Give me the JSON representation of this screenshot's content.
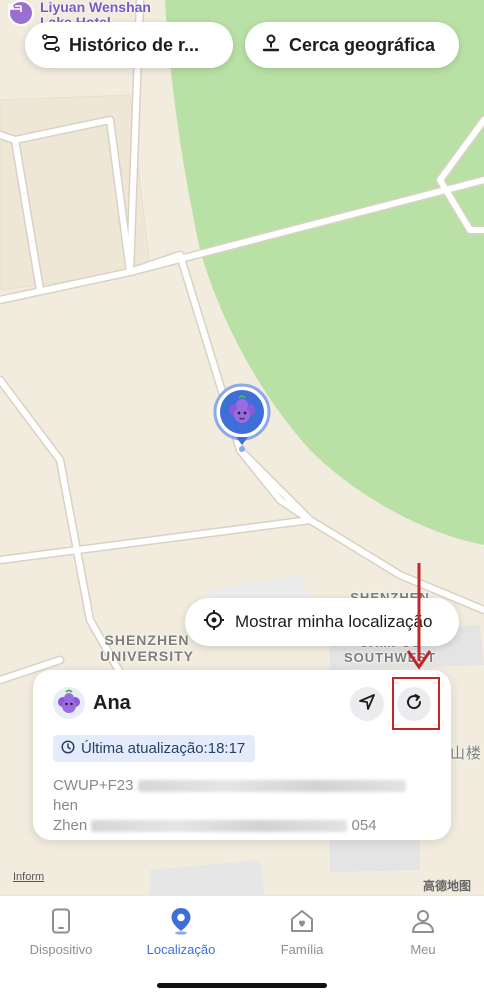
{
  "map": {
    "poi": {
      "line1": "Liyuan Wenshan",
      "line2": "Lake Hotel",
      "icon": "bed-icon"
    },
    "labels": {
      "university_l1": "SHENZHEN",
      "university_l2": "UNIVERSITY",
      "campus_l1": "SHENZHEN",
      "campus_l2": "CAMPUS",
      "campus_l3": "SOUTHWEST",
      "edge_text": "山楼"
    },
    "attribution": {
      "inform": "Inform",
      "provider": "高德地图"
    }
  },
  "top_buttons": {
    "history": {
      "label": "Histórico de r...",
      "icon": "route-icon"
    },
    "geofence": {
      "label": "Cerca geográfica",
      "icon": "location-pin-icon"
    }
  },
  "show_my_location": {
    "label": "Mostrar minha localização",
    "icon": "crosshair-icon"
  },
  "device_card": {
    "name": "Ana",
    "last_update": "Última atualização:18:17",
    "address_line1_start": "CWUP+F23",
    "address_line1_end": "hen",
    "address_line2_start": "Zhen",
    "address_line2_end": "054"
  },
  "tabs": [
    {
      "label": "Dispositivo",
      "icon": "phone-icon",
      "active": false
    },
    {
      "label": "Localização",
      "icon": "location-icon",
      "active": true
    },
    {
      "label": "Família",
      "icon": "home-heart-icon",
      "active": false
    },
    {
      "label": "Meu",
      "icon": "person-icon",
      "active": false
    }
  ],
  "colors": {
    "accent": "#3d6fd6",
    "park": "#b6e0a0",
    "annotation": "#c0262a"
  }
}
